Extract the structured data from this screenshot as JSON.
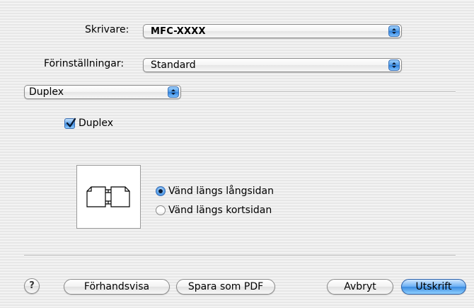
{
  "printer": {
    "label": "Skrivare:",
    "value": "MFC-XXXX"
  },
  "presets": {
    "label": "Förinställningar:",
    "value": "Standard"
  },
  "panel": {
    "value": "Duplex"
  },
  "duplex": {
    "label": "Duplex",
    "checked": true
  },
  "binding": {
    "options": [
      "Vänd längs långsidan",
      "Vänd längs kortsidan"
    ],
    "selected": 0
  },
  "buttons": {
    "help": "?",
    "preview": "Förhandsvisa",
    "save_pdf": "Spara som PDF",
    "cancel": "Avbryt",
    "print": "Utskrift"
  },
  "colors": {
    "accent": "#3b8be0",
    "window": "#ececec"
  },
  "icons": {
    "arrows": "popup-arrows-icon",
    "check": "checkmark-icon",
    "preview": "duplex-long-edge-icon"
  }
}
